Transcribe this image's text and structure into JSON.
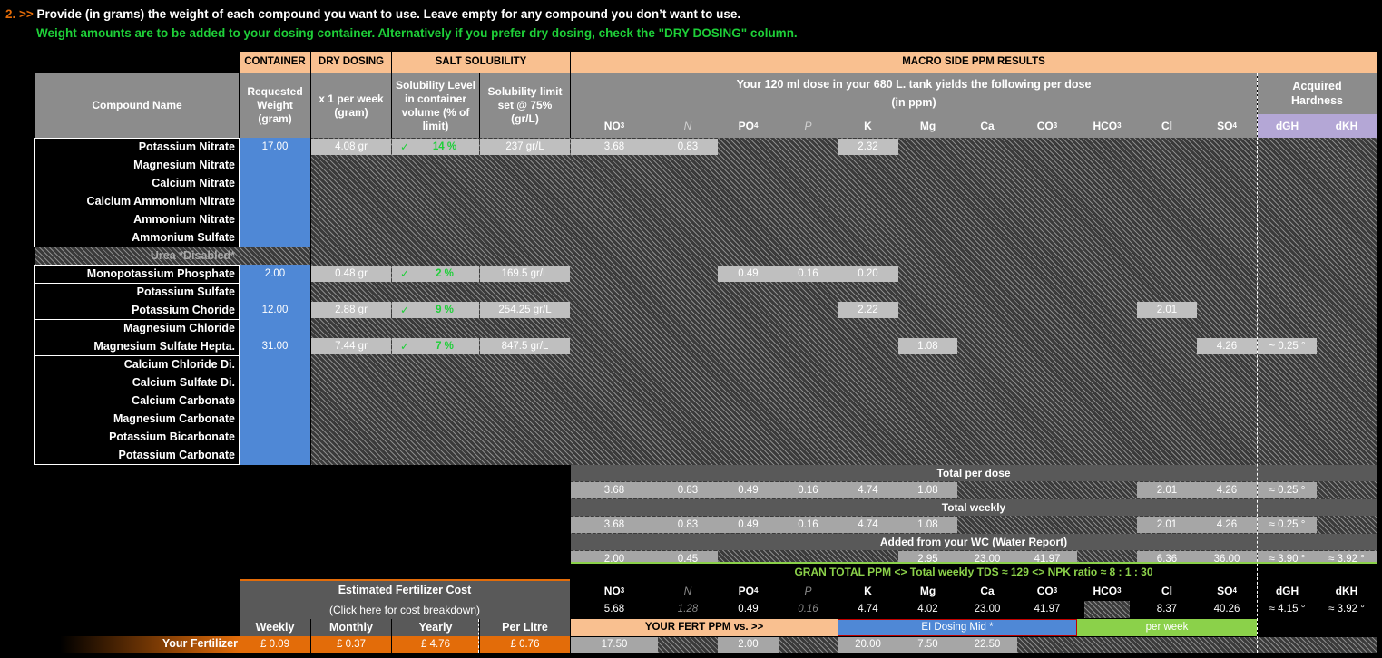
{
  "instructions": {
    "step": "2. >>",
    "line1": "Provide (in grams) the weight of each compound you want to use. Leave empty for any compound you don’t want to use.",
    "line2": "Weight amounts are to be added to your dosing container. Alternatively if you prefer dry dosing, check the \"DRY DOSING\" column."
  },
  "headers": {
    "container": "CONTAINER",
    "dry_dosing": "DRY DOSING",
    "salt_solubility": "SALT SOLUBILITY",
    "macro": "MACRO SIDE PPM RESULTS",
    "compound_name": "Compound Name",
    "requested_weight": "Requested Weight (gram)",
    "per_week": "x 1 per week (gram)",
    "solubility_level": "Solubility Level in container volume (% of limit)",
    "solubility_limit": "Solubility limit set @ 75% (gr/L)",
    "dose_line1": "Your 120 ml dose in your 680 L. tank yields the following per dose",
    "dose_line2": "(in ppm)",
    "acquired_hardness": "Acquired Hardness"
  },
  "ion_columns": [
    "NO₃",
    "N",
    "PO₄",
    "P",
    "K",
    "Mg",
    "Ca",
    "CO₃",
    "HCO₃",
    "Cl",
    "SO₄"
  ],
  "hardness_columns": [
    "dGH",
    "dKH"
  ],
  "compounds": [
    {
      "name": "Potassium Nitrate",
      "weight": "17.00",
      "dry": "4.08 gr",
      "check": "✓",
      "sol_pct": "14 %",
      "limit": "237 gr/L",
      "ppm": [
        "3.68",
        "0.83",
        "",
        "",
        "2.32",
        "",
        "",
        "",
        "",
        "",
        ""
      ],
      "hard": [
        "",
        ""
      ]
    },
    {
      "name": "Magnesium Nitrate",
      "weight": "",
      "dry": "",
      "check": "",
      "sol_pct": "",
      "limit": "",
      "ppm": [],
      "hard": []
    },
    {
      "name": "Calcium Nitrate",
      "weight": "",
      "dry": "",
      "check": "",
      "sol_pct": "",
      "limit": "",
      "ppm": [],
      "hard": []
    },
    {
      "name": "Calcium Ammonium Nitrate",
      "weight": "",
      "dry": "",
      "check": "",
      "sol_pct": "",
      "limit": "",
      "ppm": [],
      "hard": []
    },
    {
      "name": "Ammonium Nitrate",
      "weight": "",
      "dry": "",
      "check": "",
      "sol_pct": "",
      "limit": "",
      "ppm": [],
      "hard": []
    },
    {
      "name": "Ammonium Sulfate",
      "weight": "",
      "dry": "",
      "check": "",
      "sol_pct": "",
      "limit": "",
      "ppm": [],
      "hard": []
    },
    {
      "name": "Urea *Disabled*",
      "disabled": true,
      "weight": "",
      "dry": "",
      "check": "",
      "sol_pct": "",
      "limit": "",
      "ppm": [],
      "hard": []
    },
    {
      "name": "Monopotassium Phosphate",
      "weight": "2.00",
      "dry": "0.48 gr",
      "check": "✓",
      "sol_pct": "2 %",
      "limit": "169.5 gr/L",
      "ppm": [
        "",
        "",
        "0.49",
        "0.16",
        "0.20",
        "",
        "",
        "",
        "",
        "",
        ""
      ],
      "hard": [
        "",
        ""
      ]
    },
    {
      "name": "Potassium Sulfate",
      "weight": "",
      "dry": "",
      "check": "",
      "sol_pct": "",
      "limit": "",
      "ppm": [],
      "hard": []
    },
    {
      "name": "Potassium Choride",
      "weight": "12.00",
      "dry": "2.88 gr",
      "check": "✓",
      "sol_pct": "9 %",
      "limit": "254.25 gr/L",
      "ppm": [
        "",
        "",
        "",
        "",
        "2.22",
        "",
        "",
        "",
        "",
        "2.01",
        ""
      ],
      "hard": [
        "",
        ""
      ]
    },
    {
      "name": "Magnesium Chloride",
      "weight": "",
      "dry": "",
      "check": "",
      "sol_pct": "",
      "limit": "",
      "ppm": [],
      "hard": []
    },
    {
      "name": "Magnesium Sulfate Hepta.",
      "weight": "31.00",
      "dry": "7.44 gr",
      "check": "✓",
      "sol_pct": "7 %",
      "limit": "847.5 gr/L",
      "ppm": [
        "",
        "",
        "",
        "",
        "",
        "1.08",
        "",
        "",
        "",
        "",
        "4.26"
      ],
      "hard": [
        "~ 0.25 °",
        ""
      ]
    },
    {
      "name": "Calcium Chloride Di.",
      "weight": "",
      "dry": "",
      "check": "",
      "sol_pct": "",
      "limit": "",
      "ppm": [],
      "hard": []
    },
    {
      "name": "Calcium Sulfate Di.",
      "weight": "",
      "dry": "",
      "check": "",
      "sol_pct": "",
      "limit": "",
      "ppm": [],
      "hard": []
    },
    {
      "name": "Calcium Carbonate",
      "weight": "",
      "dry": "",
      "check": "",
      "sol_pct": "",
      "limit": "",
      "ppm": [],
      "hard": []
    },
    {
      "name": "Magnesium Carbonate",
      "weight": "",
      "dry": "",
      "check": "",
      "sol_pct": "",
      "limit": "",
      "ppm": [],
      "hard": []
    },
    {
      "name": "Potassium Bicarbonate",
      "weight": "",
      "dry": "",
      "check": "",
      "sol_pct": "",
      "limit": "",
      "ppm": [],
      "hard": []
    },
    {
      "name": "Potassium Carbonate",
      "weight": "",
      "dry": "",
      "check": "",
      "sol_pct": "",
      "limit": "",
      "ppm": [],
      "hard": []
    }
  ],
  "totals": [
    {
      "label": "Total per dose",
      "values": [
        "3.68",
        "0.83",
        "0.49",
        "0.16",
        "4.74",
        "1.08",
        "",
        "",
        "",
        "2.01",
        "4.26"
      ],
      "hard": [
        "≈ 0.25 °",
        ""
      ]
    },
    {
      "label": "Total weekly",
      "values": [
        "3.68",
        "0.83",
        "0.49",
        "0.16",
        "4.74",
        "1.08",
        "",
        "",
        "",
        "2.01",
        "4.26"
      ],
      "hard": [
        "≈ 0.25 °",
        ""
      ]
    },
    {
      "label": "Added from your WC (Water Report)",
      "values": [
        "2.00",
        "0.45",
        "",
        "",
        "",
        "2.95",
        "23.00",
        "41.97",
        "",
        "6.36",
        "36.00"
      ],
      "hard": [
        "≈ 3.90 °",
        "≈ 3.92 °"
      ]
    }
  ],
  "grand_total": {
    "label": "GRAN TOTAL PPM <> Total weekly TDS ≈ 129 <> NPK ratio ≈ 8 : 1 : 30",
    "values": [
      "5.68",
      "1.28",
      "0.49",
      "0.16",
      "4.74",
      "4.02",
      "23.00",
      "41.97",
      "",
      "8.37",
      "40.26"
    ],
    "hard": [
      "≈ 4.15 °",
      "≈ 3.92 °"
    ]
  },
  "compare": {
    "label": "YOUR FERT PPM vs.  >>",
    "target": "EI Dosing Mid *",
    "period": "per week",
    "values": [
      "17.50",
      "",
      "2.00",
      "",
      "20.00",
      "7.50",
      "22.50",
      "",
      "",
      "",
      ""
    ]
  },
  "cost": {
    "title": "Estimated Fertilizer Cost",
    "subtitle": "(Click here for cost breakdown)",
    "columns": [
      "Weekly",
      "Monthly",
      "Yearly",
      "Per Litre"
    ],
    "row_label": "Your Fertilizer",
    "values": [
      "£ 0.09",
      "£ 0.37",
      "£ 4.76",
      "£ 0.76"
    ]
  },
  "colors": {
    "accent_orange": "#e36c09",
    "header_peach": "#f9c090",
    "input_blue": "#4f88d6",
    "check_green": "#1ecf38",
    "hardness_purple": "#b4a7d6",
    "per_week_green": "#8bd14a"
  }
}
